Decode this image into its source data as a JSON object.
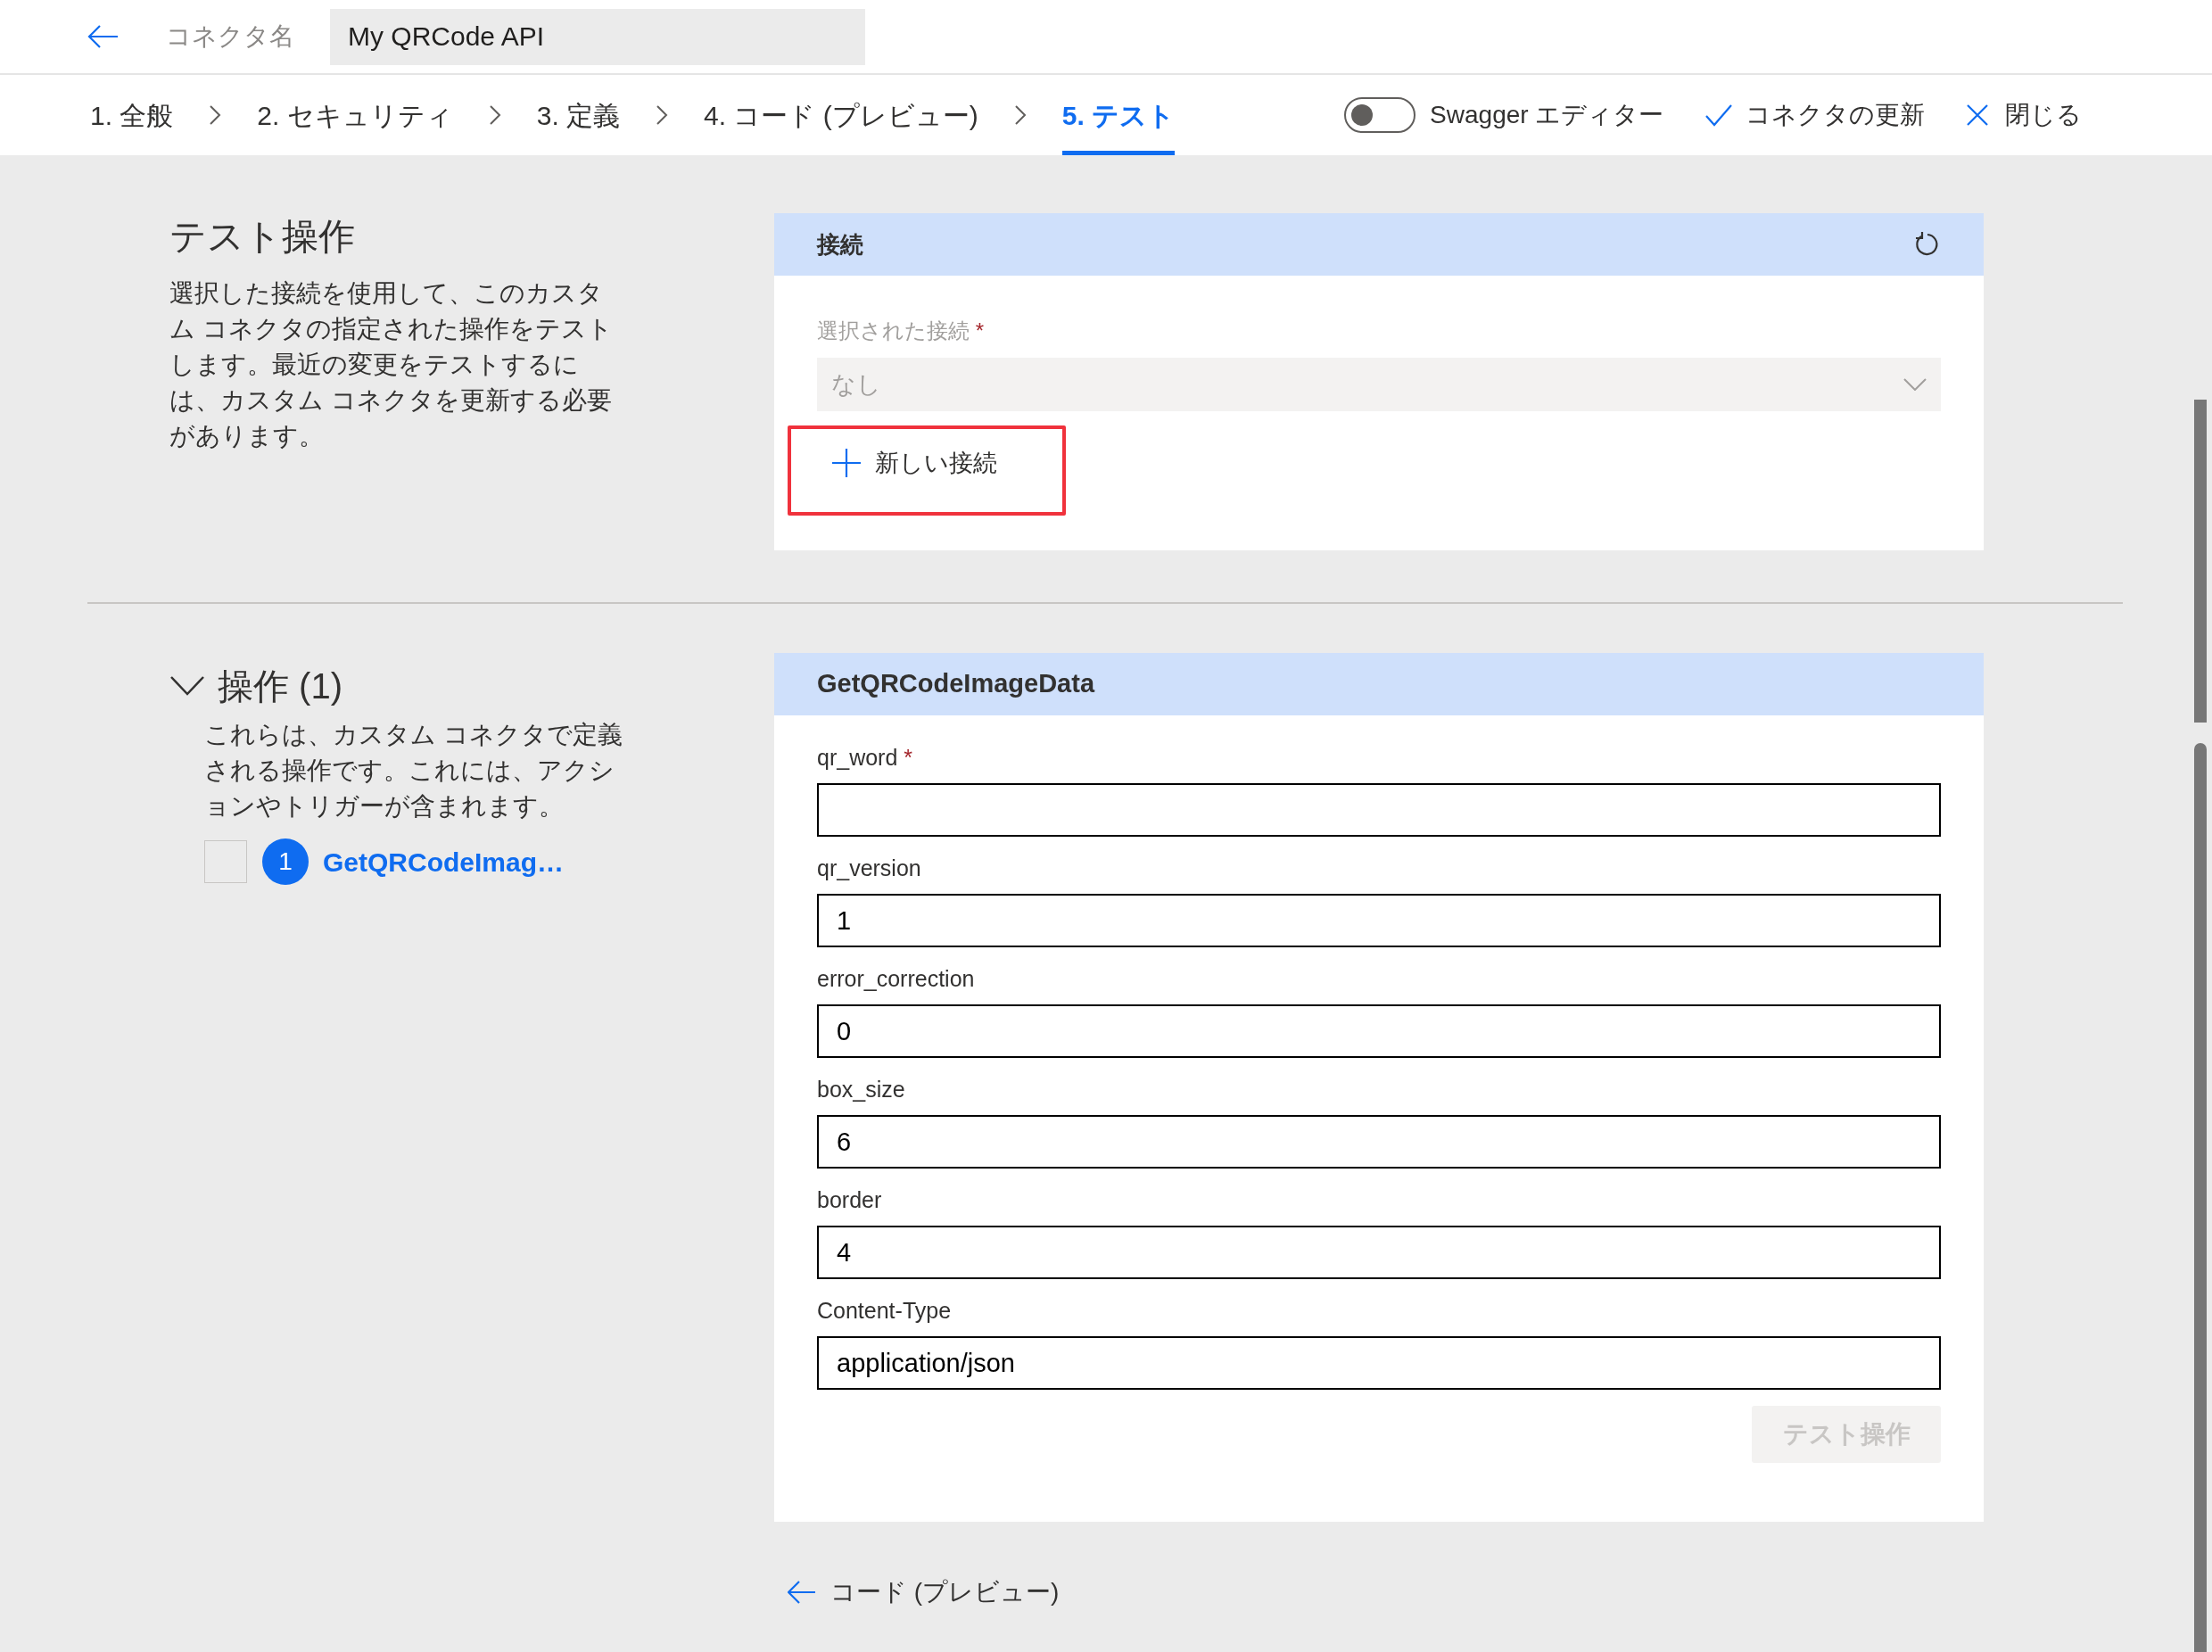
{
  "header": {
    "connector_name_label": "コネクタ名",
    "connector_name_value": "My QRCode API"
  },
  "steps": [
    {
      "label": "1. 全般",
      "selected": false
    },
    {
      "label": "2. セキュリティ",
      "selected": false
    },
    {
      "label": "3. 定義",
      "selected": false
    },
    {
      "label": "4. コード (プレビュー)",
      "selected": false
    },
    {
      "label": "5. テスト",
      "selected": true
    }
  ],
  "toolbar": {
    "swagger_toggle": {
      "label": "Swagger エディター",
      "on": false
    },
    "update_button": "コネクタの更新",
    "close_button": "閉じる"
  },
  "test_section": {
    "title": "テスト操作",
    "description": "選択した接続を使用して、このカスタム コネクタの指定された操作をテストします。最近の変更をテストするには、カスタム コネクタを更新する必要があります。"
  },
  "connection_card": {
    "title": "接続",
    "selected_connection": {
      "label": "選択された接続",
      "required_mark": "*",
      "value": "なし"
    },
    "new_connection_button": "新しい接続"
  },
  "operations": {
    "title": "操作 (1)",
    "expanded": true,
    "description": "これらは、カスタム コネクタで定義される操作です。これには、アクションやトリガーが含まれます。",
    "items": [
      {
        "number": "1",
        "label": "GetQRCodeImag…",
        "checked": false
      }
    ]
  },
  "operation_card": {
    "title": "GetQRCodeImageData",
    "fields": [
      {
        "label": "qr_word",
        "required_mark": "*"
      },
      {
        "label": "qr_version",
        "value": "1"
      },
      {
        "label": "error_correction",
        "value": "0"
      },
      {
        "label": "box_size",
        "value": "6"
      },
      {
        "label": "border",
        "value": "4"
      },
      {
        "label": "Content-Type",
        "value": "application/json"
      }
    ],
    "submit_button": {
      "label": "テスト操作",
      "disabled": true
    }
  },
  "back_link": "コード (プレビュー)"
}
